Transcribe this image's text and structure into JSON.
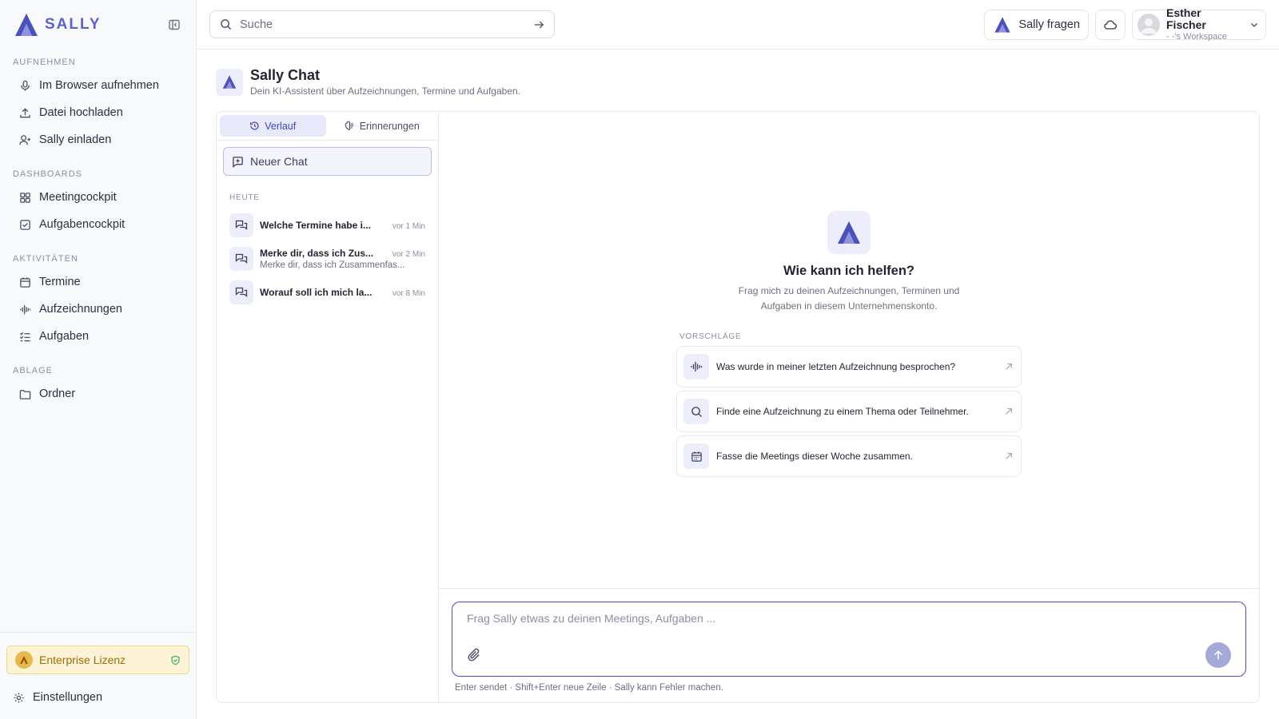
{
  "app": {
    "brand": "SALLY",
    "accent": "#5b63c9"
  },
  "sidebar": {
    "sections": [
      {
        "label": "AUFNEHMEN",
        "items": [
          {
            "label": "Im Browser aufnehmen",
            "icon": "microphone-icon"
          },
          {
            "label": "Datei hochladen",
            "icon": "upload-icon"
          },
          {
            "label": "Sally einladen",
            "icon": "user-plus-icon"
          }
        ]
      },
      {
        "label": "DASHBOARDS",
        "items": [
          {
            "label": "Meetingcockpit",
            "icon": "grid-icon"
          },
          {
            "label": "Aufgabencockpit",
            "icon": "checkbox-icon"
          }
        ]
      },
      {
        "label": "AKTIVITÄTEN",
        "items": [
          {
            "label": "Termine",
            "icon": "calendar-icon"
          },
          {
            "label": "Aufzeichnungen",
            "icon": "waveform-icon"
          },
          {
            "label": "Aufgaben",
            "icon": "list-check-icon"
          }
        ]
      },
      {
        "label": "ABLAGE",
        "items": [
          {
            "label": "Ordner",
            "icon": "folder-icon"
          }
        ]
      }
    ],
    "license": "Enterprise Lizenz",
    "settings": "Einstellungen"
  },
  "topbar": {
    "search_placeholder": "Suche",
    "ask_label": "Sally fragen",
    "user_name": "Esther Fischer",
    "user_workspace": "- -'s Workspace"
  },
  "page": {
    "title": "Sally Chat",
    "subtitle": "Dein KI-Assistent über Aufzeichnungen, Termine und Aufgaben."
  },
  "history": {
    "tabs": [
      "Verlauf",
      "Erinnerungen"
    ],
    "new_chat": "Neuer Chat",
    "group": "HEUTE",
    "chats": [
      {
        "title": "Welche Termine habe i...",
        "time": "vor 1 Min",
        "preview": ""
      },
      {
        "title": "Merke dir, dass ich Zus...",
        "time": "vor 2 Min",
        "preview": "Merke dir, dass ich Zusammenfas..."
      },
      {
        "title": "Worauf soll ich mich la...",
        "time": "vor 8 Min",
        "preview": ""
      }
    ]
  },
  "chat": {
    "hero_title": "Wie kann ich helfen?",
    "hero_sub": "Frag mich zu deinen Aufzeichnungen, Terminen und Aufgaben in diesem Unternehmenskonto.",
    "suggest_label": "VORSCHLÄGE",
    "suggestions": [
      {
        "text": "Was wurde in meiner letzten Aufzeichnung besprochen?",
        "icon": "waveform-icon"
      },
      {
        "text": "Finde eine Aufzeichnung zu einem Thema oder Teilnehmer.",
        "icon": "search-icon"
      },
      {
        "text": "Fasse die Meetings dieser Woche zusammen.",
        "icon": "calendar-icon"
      }
    ],
    "composer_placeholder": "Frag Sally etwas zu deinen Meetings, Aufgaben ...",
    "hint": "Enter sendet · Shift+Enter neue Zeile · Sally kann Fehler machen."
  }
}
